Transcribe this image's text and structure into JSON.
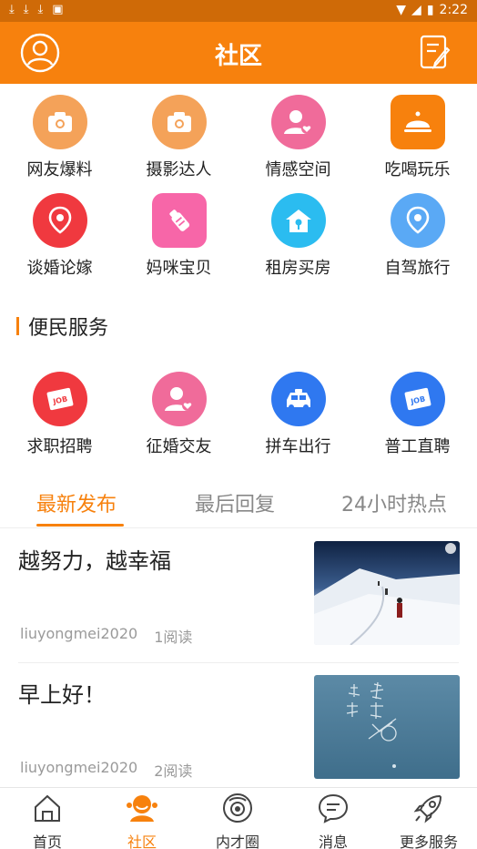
{
  "status_bar": {
    "time": "2:22"
  },
  "header": {
    "title": "社区"
  },
  "categories": [
    {
      "label": "网友爆料",
      "icon": "camera-icon",
      "color": "#f4a259"
    },
    {
      "label": "摄影达人",
      "icon": "camera-icon",
      "color": "#f4a259"
    },
    {
      "label": "情感空间",
      "icon": "user-heart-icon",
      "color": "#f06b9a"
    },
    {
      "label": "吃喝玩乐",
      "icon": "food-cloche-icon",
      "color": "#f7810d"
    },
    {
      "label": "谈婚论嫁",
      "icon": "map-pin-icon",
      "color": "#f0393f"
    },
    {
      "label": "妈咪宝贝",
      "icon": "baby-bottle-icon",
      "color": "#f766a8"
    },
    {
      "label": "租房买房",
      "icon": "house-key-icon",
      "color": "#2bbcf0"
    },
    {
      "label": "自驾旅行",
      "icon": "map-pin-icon",
      "color": "#5aa9f5"
    }
  ],
  "services_section": {
    "title": "便民服务"
  },
  "services": [
    {
      "label": "求职招聘",
      "icon": "job-card-icon",
      "color": "#f0393f"
    },
    {
      "label": "征婚交友",
      "icon": "user-heart-icon",
      "color": "#f06b9a"
    },
    {
      "label": "拼车出行",
      "icon": "taxi-icon",
      "color": "#2f78f0"
    },
    {
      "label": "普工直聘",
      "icon": "job-card-icon",
      "color": "#2f78f0"
    }
  ],
  "tabs": [
    {
      "label": "最新发布",
      "active": true
    },
    {
      "label": "最后回复",
      "active": false
    },
    {
      "label": "24小时热点",
      "active": false
    }
  ],
  "posts": [
    {
      "title": "越努力，越幸福",
      "author": "liuyongmei2020",
      "reads": "1阅读"
    },
    {
      "title": "早上好！",
      "author": "liuyongmei2020",
      "reads": "2阅读"
    }
  ],
  "bottom_nav": [
    {
      "label": "首页",
      "icon": "home-icon",
      "active": false
    },
    {
      "label": "社区",
      "icon": "community-icon",
      "active": true
    },
    {
      "label": "内才圈",
      "icon": "circle-icon",
      "active": false
    },
    {
      "label": "消息",
      "icon": "message-icon",
      "active": false
    },
    {
      "label": "更多服务",
      "icon": "rocket-icon",
      "active": false
    }
  ],
  "colors": {
    "brand": "#f7810d",
    "status_bar": "#cf6a07"
  }
}
